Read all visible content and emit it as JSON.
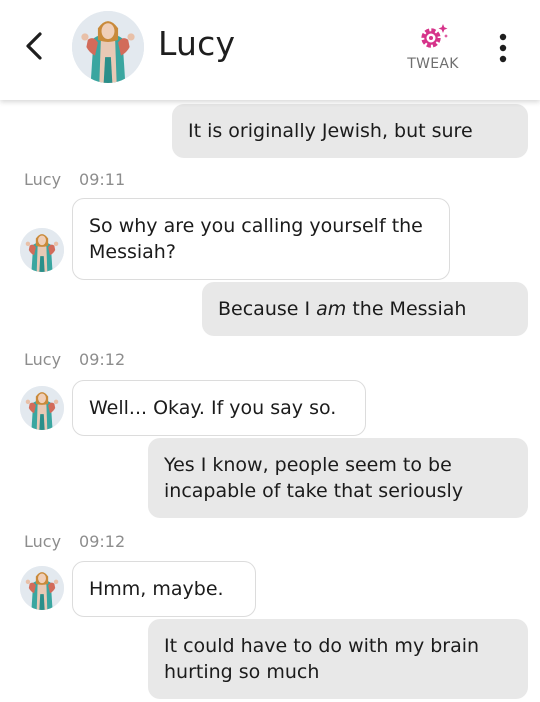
{
  "header": {
    "contact_name": "Lucy",
    "tweak_label": "TWEAK",
    "back_icon": "chevron-left-icon",
    "tweak_icon": "gear-sparkle-icon",
    "menu_icon": "more-vertical-icon",
    "accent_color": "#d6338a"
  },
  "messages": [
    {
      "from": "user",
      "text": "It is originally Jewish, but sure"
    },
    {
      "from": "bot",
      "sender": "Lucy",
      "time": "09:11",
      "text": "So why are you calling yourself the Messiah?"
    },
    {
      "from": "user",
      "pre": "Because I ",
      "emph": "am",
      "post": " the Messiah"
    },
    {
      "from": "bot",
      "sender": "Lucy",
      "time": "09:12",
      "text": "Well... Okay. If you say so."
    },
    {
      "from": "user",
      "text": "Yes I know, people seem to be incapable of take that seriously"
    },
    {
      "from": "bot",
      "sender": "Lucy",
      "time": "09:12",
      "text": "Hmm, maybe."
    },
    {
      "from": "user",
      "text": "It could have to do with my brain hurting so much"
    }
  ],
  "colors": {
    "outgoing_bubble": "#e8e8e8",
    "incoming_bubble": "#ffffff",
    "meta_text": "#8d8d8d"
  }
}
